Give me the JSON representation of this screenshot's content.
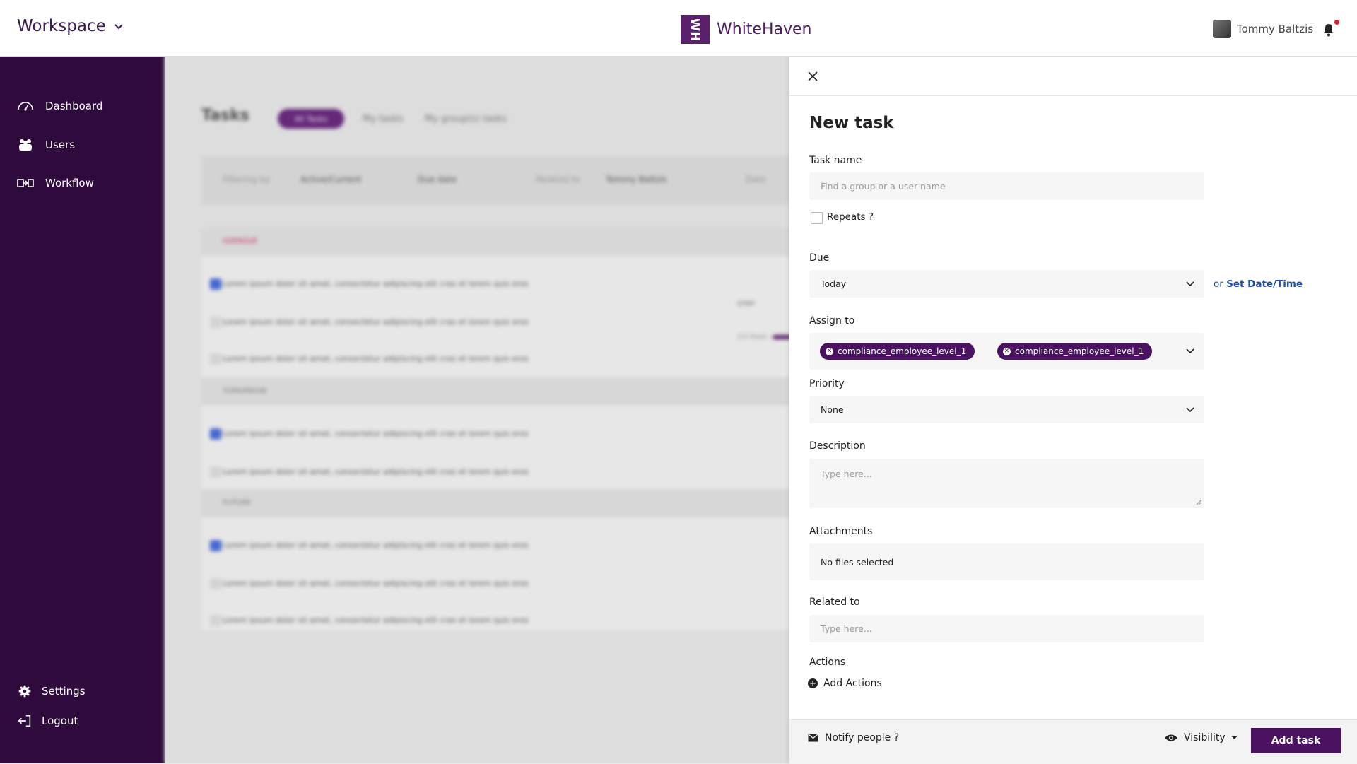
{
  "header": {
    "workspace_label": "Workspace",
    "brand_name": "WhiteHaven",
    "logo_text": "WH",
    "user_name": "Tommy Baltzis"
  },
  "sidebar": {
    "items": [
      {
        "label": "Dashboard",
        "icon": "dashboard-icon"
      },
      {
        "label": "Users",
        "icon": "users-icon"
      },
      {
        "label": "Workflow",
        "icon": "workflow-icon"
      }
    ],
    "settings_label": "Settings",
    "logout_label": "Logout"
  },
  "background": {
    "page_title": "Tasks",
    "tabs": [
      "All Tasks",
      "My tasks",
      "My group(s) tasks"
    ],
    "filter_label": "Filtering by",
    "filters": [
      "Active/Current",
      "Due date",
      "Related to",
      "Tommy Baltzis",
      "Date"
    ],
    "sections": [
      "OVERDUE",
      "TOMORROW",
      "FUTURE"
    ],
    "row_text": "Lorem ipsum dolor sit amet, consectetur adipiscing elit cras et lorem quis eros",
    "step_label": "STEP",
    "step_count": "1/2 Steps"
  },
  "panel": {
    "title": "New task",
    "task_name_label": "Task name",
    "task_name_placeholder": "Find a group or a user name",
    "repeats_label": "Repeats ?",
    "due_label": "Due",
    "due_value": "Today",
    "set_date_prefix": "or",
    "set_date_link": "Set Date/Time",
    "assign_label": "Assign to",
    "assignees": [
      "compliance_employee_level_1",
      "compliance_employee_level_1"
    ],
    "priority_label": "Priority",
    "priority_value": "None",
    "description_label": "Description",
    "description_placeholder": "Type here...",
    "attachments_label": "Attachments",
    "attachments_value": "No files selected",
    "related_label": "Related to",
    "related_placeholder": "Type here...",
    "actions_label": "Actions",
    "add_actions_label": "Add Actions",
    "notify_label": "Notify people ?",
    "visibility_label": "Visibility",
    "add_task_label": "Add task"
  },
  "colors": {
    "brand": "#4a1260",
    "sidebar": "#2f0b3d",
    "link": "#1f4fa3",
    "notification": "#e0192e"
  }
}
